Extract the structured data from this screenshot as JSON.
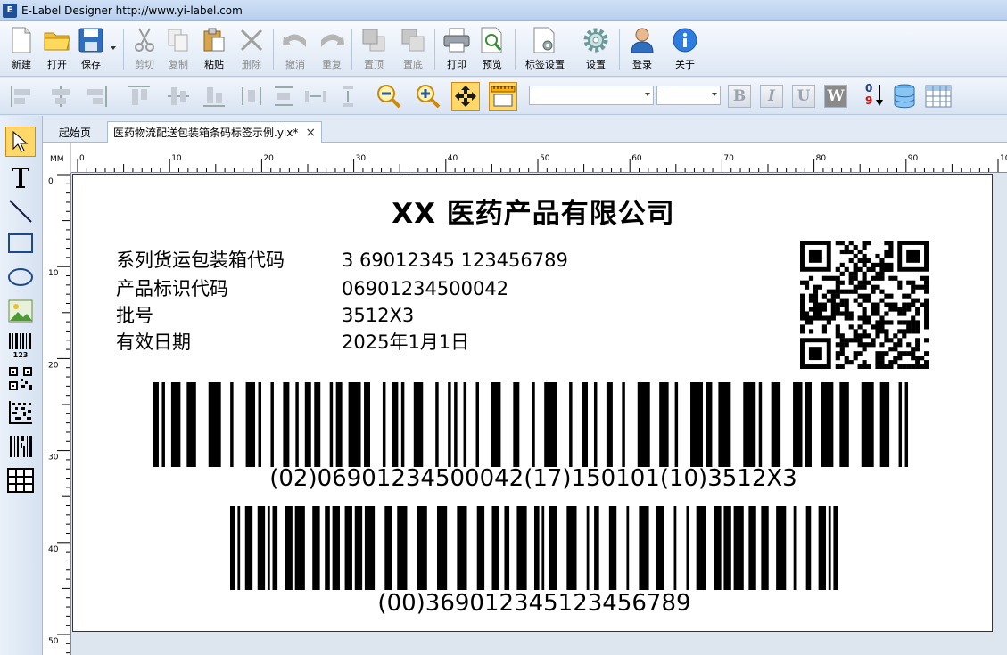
{
  "window": {
    "title": "E-Label Designer http://www.yi-label.com"
  },
  "toolbar": {
    "new": "新建",
    "open": "打开",
    "save": "保存",
    "cut": "剪切",
    "copy": "复制",
    "paste": "粘贴",
    "delete": "删除",
    "undo": "撤消",
    "redo": "重复",
    "to_top": "置顶",
    "to_bottom": "置底",
    "print": "打印",
    "preview": "预览",
    "label_settings": "标签设置",
    "settings": "设置",
    "login": "登录",
    "about": "关于"
  },
  "format_bar": {
    "bold": "B",
    "italic": "I",
    "underline": "U",
    "wordwrap": "W",
    "serial_top": "0",
    "serial_bottom": "9"
  },
  "tabs": {
    "start": "起始页",
    "document": "医药物流配送包装箱条码标签示例.yix*",
    "close": "×"
  },
  "ruler": {
    "unit": "MM",
    "h_labels": [
      "0",
      "10",
      "20",
      "30",
      "40",
      "50",
      "60",
      "70",
      "80",
      "90",
      "10"
    ],
    "v_labels": [
      "0",
      "10",
      "20",
      "30",
      "40",
      "50"
    ]
  },
  "label": {
    "company": "XX 医药产品有限公司",
    "fields": [
      {
        "key": "系列货运包装箱代码",
        "value": "3 69012345 123456789"
      },
      {
        "key": "产品标识代码",
        "value": "06901234500042"
      },
      {
        "key": "批号",
        "value": "3512X3"
      },
      {
        "key": "有效日期",
        "value": "2025年1月1日"
      }
    ],
    "barcode1_text": "(02)06901234500042(17)150101(10)3512X3",
    "barcode2_text": "(00)369012345123456789"
  }
}
